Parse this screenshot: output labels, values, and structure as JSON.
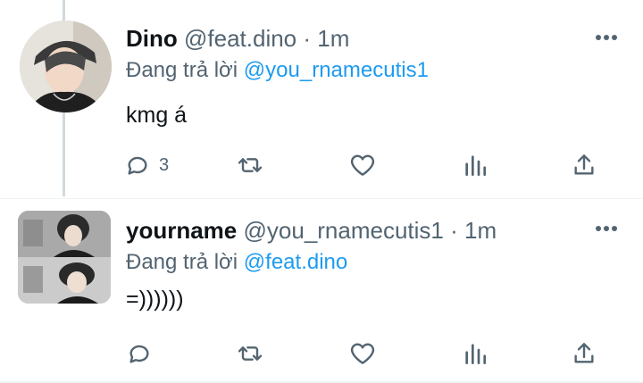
{
  "tweets": [
    {
      "display_name": "Dino",
      "handle": "@feat.dino",
      "separator": " · ",
      "time": "1m",
      "replying_prefix": "Đang trả lời ",
      "replying_to": "@you_rnamecutis1",
      "text": "kmg á",
      "reply_count": "3",
      "avatar_icon": "profile-photo"
    },
    {
      "display_name": "yourname",
      "handle": "@you_rnamecutis1",
      "separator": " · ",
      "time": "1m",
      "replying_prefix": "Đang trả lời ",
      "replying_to": "@feat.dino",
      "text": "=))))))",
      "reply_count": "",
      "avatar_icon": "profile-photo-collage"
    }
  ],
  "colors": {
    "link": "#1d9bf0",
    "secondary_text": "#536471",
    "icon": "#536471",
    "thread_line": "#cfd9de"
  },
  "icons": [
    "more-icon",
    "reply-icon",
    "retweet-icon",
    "like-icon",
    "views-icon",
    "share-icon"
  ]
}
